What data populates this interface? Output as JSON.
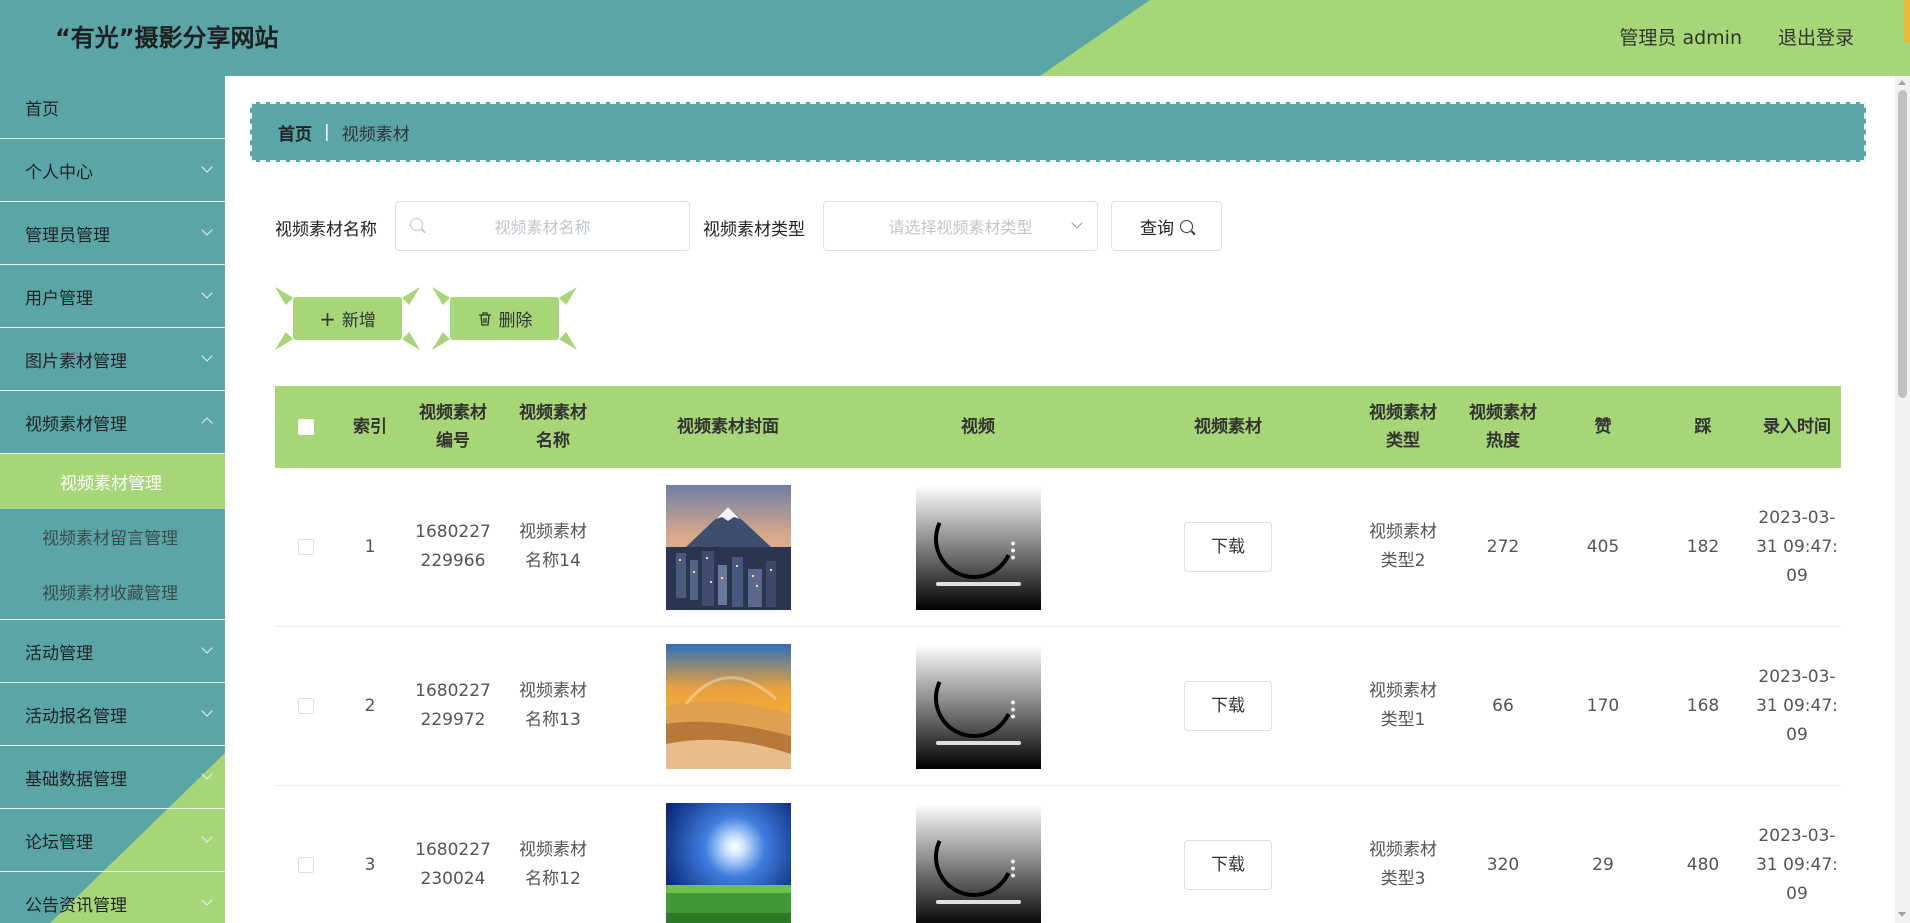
{
  "header": {
    "title": "“有光”摄影分享网站",
    "admin": "管理员 admin",
    "logout": "退出登录"
  },
  "sidebar": {
    "items": [
      {
        "label": "首页"
      },
      {
        "label": "个人中心"
      },
      {
        "label": "管理员管理"
      },
      {
        "label": "用户管理"
      },
      {
        "label": "图片素材管理"
      },
      {
        "label": "视频素材管理"
      },
      {
        "label": "活动管理"
      },
      {
        "label": "活动报名管理"
      },
      {
        "label": "基础数据管理"
      },
      {
        "label": "论坛管理"
      },
      {
        "label": "公告资讯管理"
      }
    ],
    "submenu": [
      "视频素材管理",
      "视频素材留言管理",
      "视频素材收藏管理"
    ]
  },
  "breadcrumb": {
    "home": "首页",
    "separator": "|",
    "current": "视频素材"
  },
  "search": {
    "name_label": "视频素材名称",
    "name_placeholder": "视频素材名称",
    "type_label": "视频素材类型",
    "type_placeholder": "请选择视频素材类型",
    "query_button": "查询"
  },
  "actions": {
    "add": "新增",
    "delete": "删除"
  },
  "table": {
    "headers": [
      "索引",
      "视频素材\n编号",
      "视频素材\n名称",
      "视频素材封面",
      "视频",
      "视频素材",
      "视频素材\n类型",
      "视频素材\n热度",
      "赞",
      "踩",
      "录入时间"
    ],
    "download_label": "下载",
    "rows": [
      {
        "index": "1",
        "code": "1680227\n229966",
        "name": "视频素材\n名称14",
        "cover": "mountain-city",
        "type": "视频素材\n类型2",
        "heat": "272",
        "like": "405",
        "dislike": "182",
        "time": "2023-03-\n31 09:47:\n09"
      },
      {
        "index": "2",
        "code": "1680227\n229972",
        "name": "视频素材\n名称13",
        "cover": "sunset-beach",
        "type": "视频素材\n类型1",
        "heat": "66",
        "like": "170",
        "dislike": "168",
        "time": "2023-03-\n31 09:47:\n09"
      },
      {
        "index": "3",
        "code": "1680227\n230024",
        "name": "视频素材\n名称12",
        "cover": "sky-meadow",
        "type": "视频素材\n类型3",
        "heat": "320",
        "like": "29",
        "dislike": "480",
        "time": "2023-03-\n31 09:47:\n09"
      }
    ]
  },
  "colors": {
    "teal": "#5aa6a7",
    "green": "#a6d676"
  }
}
